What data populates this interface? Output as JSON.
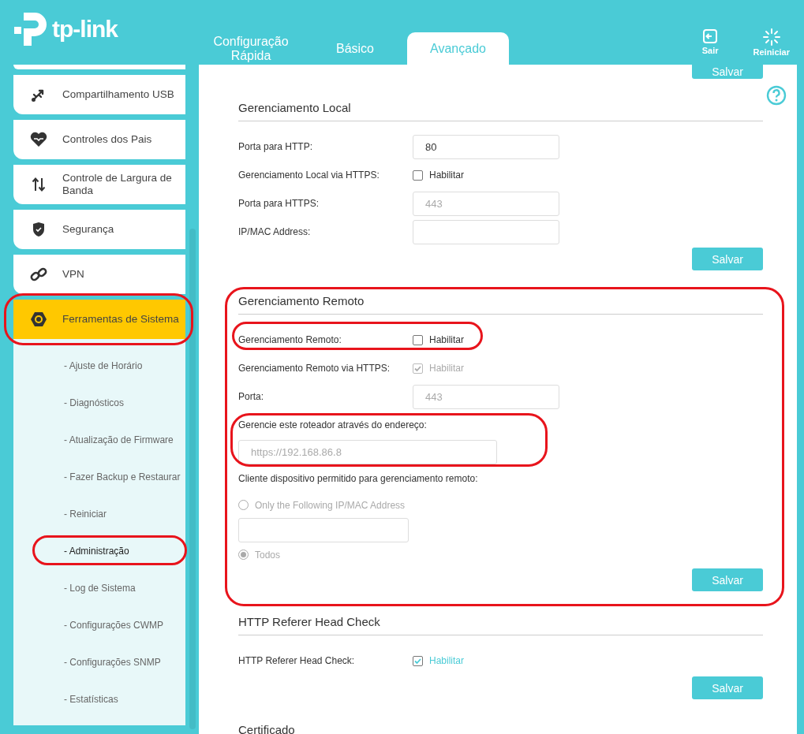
{
  "header": {
    "logo": "tp-link",
    "tabs": [
      {
        "label": "Configuração Rápida",
        "selected": false
      },
      {
        "label": "Básico",
        "selected": false
      },
      {
        "label": "Avançado",
        "selected": true
      }
    ],
    "actions": [
      {
        "kind": "logout",
        "label": "Sair"
      },
      {
        "kind": "reboot",
        "label": "Reiniciar"
      }
    ]
  },
  "sidebar": {
    "items": [
      {
        "kind": "usb",
        "label": "Compartilhamento USB",
        "selected": false
      },
      {
        "kind": "heart",
        "label": "Controles dos Pais",
        "selected": false
      },
      {
        "kind": "arrows",
        "label": "Controle de Largura de Banda",
        "selected": false
      },
      {
        "kind": "shield",
        "label": "Segurança",
        "selected": false
      },
      {
        "kind": "link",
        "label": "VPN",
        "selected": false
      },
      {
        "kind": "gear",
        "label": "Ferramentas de Sistema",
        "selected": true,
        "children": [
          {
            "label": "- Ajuste de Horário",
            "selected": false
          },
          {
            "label": "- Diagnósticos",
            "selected": false
          },
          {
            "label": "- Atualização de Firmware",
            "selected": false
          },
          {
            "label": "- Fazer Backup e Restaurar",
            "selected": false
          },
          {
            "label": "- Reiniciar",
            "selected": false
          },
          {
            "label": "- Administração",
            "selected": true
          },
          {
            "label": "- Log de Sistema",
            "selected": false
          },
          {
            "label": "- Configurações CWMP",
            "selected": false
          },
          {
            "label": "- Configurações SNMP",
            "selected": false
          },
          {
            "label": "- Estatísticas",
            "selected": false
          }
        ]
      }
    ]
  },
  "main": {
    "top_button": "Salvar",
    "sections": [
      {
        "title": "Gerenciamento Local",
        "button": "Salvar",
        "rows": [
          {
            "kind": "input",
            "label": "Porta para HTTP:",
            "value": "80",
            "disabled": false
          },
          {
            "kind": "checkbox",
            "label": "Gerenciamento Local via HTTPS:",
            "option": "Habilitar",
            "checked": false,
            "disabled": false
          },
          {
            "kind": "input",
            "label": "Porta para HTTPS:",
            "value": "443",
            "disabled": true
          },
          {
            "kind": "input",
            "label": "IP/MAC Address:"
          }
        ]
      },
      {
        "title": "Gerenciamento Remoto",
        "button": "Salvar",
        "rows": [
          {
            "kind": "checkbox",
            "label": "Gerenciamento Remoto:",
            "option": "Habilitar",
            "checked": false,
            "disabled": false
          },
          {
            "kind": "checkbox",
            "label": "Gerenciamento Remoto via HTTPS:",
            "option": "Habilitar",
            "checked": true,
            "disabled": true
          },
          {
            "kind": "input",
            "label": "Porta:",
            "value": "443",
            "disabled": true
          },
          {
            "kind": "note",
            "label": "Gerencie este roteador através do endereço:"
          },
          {
            "kind": "wide_input",
            "value": "https://192.168.86.8",
            "disabled": true
          },
          {
            "kind": "note",
            "label": "Cliente dispositivo permitido para gerenciamento remoto:"
          },
          {
            "kind": "radio",
            "option": "Only the Following IP/MAC Address",
            "selected": false,
            "disabled": true
          },
          {
            "kind": "bare_input"
          },
          {
            "kind": "radio",
            "option": "Todos",
            "selected": true,
            "disabled": true
          }
        ]
      },
      {
        "title": "HTTP Referer Head Check",
        "button": "Salvar",
        "rows": [
          {
            "kind": "checkbox",
            "label": "HTTP Referer Head Check:",
            "option": "Habilitar",
            "checked": true,
            "disabled": false
          }
        ]
      },
      {
        "title": "Certificado"
      }
    ]
  }
}
